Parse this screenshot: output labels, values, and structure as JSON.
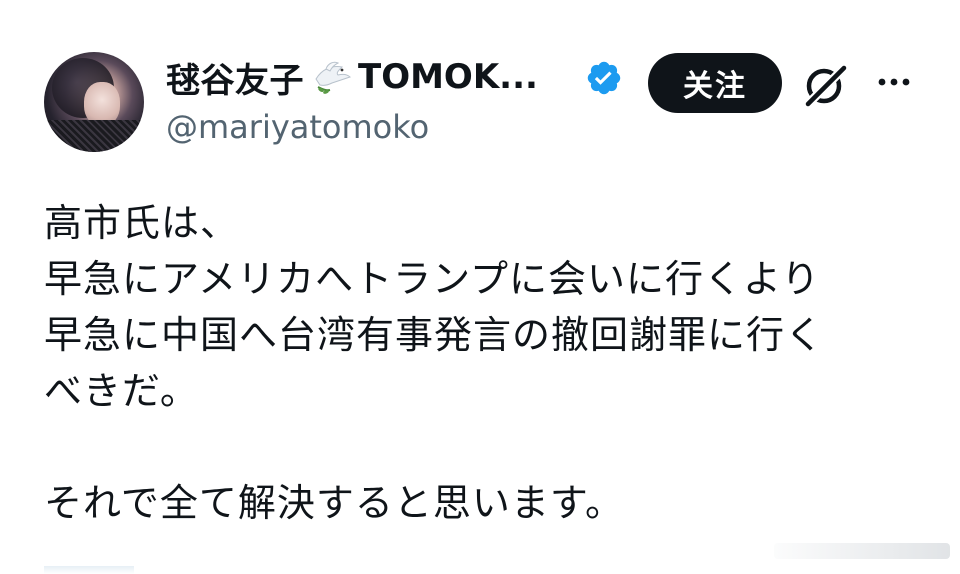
{
  "author": {
    "display_name": "毬谷友子",
    "display_name_suffix": "TOMOK...",
    "handle": "@mariyatomoko",
    "avatar_icon": "profile-photo",
    "name_emoji_icon": "dove-with-olive-branch-icon",
    "verified_icon": "verified-badge-icon"
  },
  "actions": {
    "follow_label": "关注",
    "grok_icon": "grok-icon",
    "more_icon": "more-options-icon"
  },
  "post": {
    "lines": [
      "高市氏は、",
      "早急にアメリカへトランプに会いに行くより",
      "早急に中国へ台湾有事発言の撤回謝罪に行く",
      "べきだ。",
      "",
      "それで全て解決すると思います。"
    ]
  },
  "colors": {
    "text": "#0f1419",
    "secondary": "#536471",
    "verified": "#1d9bf0",
    "follow_bg": "#0f1419"
  }
}
